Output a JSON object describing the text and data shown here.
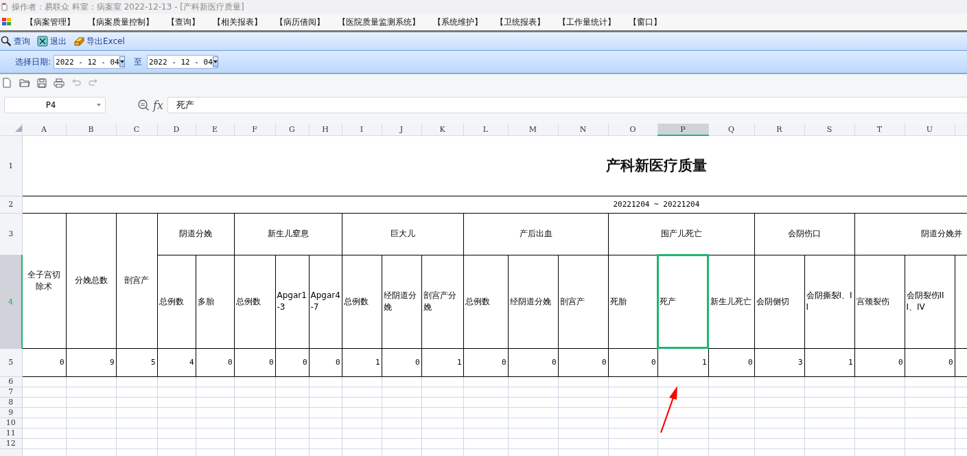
{
  "title_bar": {
    "text": "操作者：易联众  科室：病案室  2022-12-13 - [产科新医疗质量]"
  },
  "menu": [
    "【病案管理】",
    "【病案质量控制】",
    "【查询】",
    "【相关报表】",
    "【病历借阅】",
    "【医院质量监测系统】",
    "【系统维护】",
    "【卫统报表】",
    "【工作量统计】",
    "【窗口】"
  ],
  "toolbar": [
    {
      "kind": "search",
      "label": "查询"
    },
    {
      "kind": "exit",
      "label": "退出"
    },
    {
      "kind": "export",
      "label": "导出Excel"
    }
  ],
  "date_filter": {
    "label": "选择日期:",
    "from": "2022 - 12 - 04",
    "separator": "至",
    "to": "2022 - 12 - 04"
  },
  "formula_bar": {
    "cell_ref": "P4",
    "function_label": "fx",
    "formula": "死产"
  },
  "sheet": {
    "columns": [
      {
        "label": "A",
        "selected": false
      },
      {
        "label": "B",
        "selected": false
      },
      {
        "label": "C",
        "selected": false
      },
      {
        "label": "D",
        "selected": false
      },
      {
        "label": "E",
        "selected": false
      },
      {
        "label": "F",
        "selected": false
      },
      {
        "label": "G",
        "selected": false
      },
      {
        "label": "H",
        "selected": false
      },
      {
        "label": "I",
        "selected": false
      },
      {
        "label": "J",
        "selected": false
      },
      {
        "label": "K",
        "selected": false
      },
      {
        "label": "L",
        "selected": false
      },
      {
        "label": "M",
        "selected": false
      },
      {
        "label": "N",
        "selected": false
      },
      {
        "label": "O",
        "selected": false
      },
      {
        "label": "P",
        "selected": true
      },
      {
        "label": "Q",
        "selected": false
      },
      {
        "label": "R",
        "selected": false
      },
      {
        "label": "S",
        "selected": false
      },
      {
        "label": "T",
        "selected": false
      },
      {
        "label": "U",
        "selected": false
      }
    ],
    "rows": [
      {
        "label": "1",
        "selected": false
      },
      {
        "label": "2",
        "selected": false
      },
      {
        "label": "3",
        "selected": false
      },
      {
        "label": "4",
        "selected": true
      },
      {
        "label": "5",
        "selected": false
      },
      {
        "label": "6",
        "selected": false
      },
      {
        "label": "7",
        "selected": false
      },
      {
        "label": "8",
        "selected": false
      },
      {
        "label": "9",
        "selected": false
      },
      {
        "label": "10",
        "selected": false
      },
      {
        "label": "11",
        "selected": false
      },
      {
        "label": "12",
        "selected": false
      }
    ],
    "title": "产科新医疗质量",
    "date_range": "20221204  ~  20221204",
    "headers": [
      {
        "label": "全子宫切除术",
        "value": "0",
        "selected": false
      },
      {
        "label": "分娩总数",
        "value": "9",
        "selected": false
      },
      {
        "label": "剖宫产",
        "value": "5",
        "selected": false
      },
      {
        "label": "阴道分娩",
        "children": [
          {
            "label": "总例数",
            "value": "4",
            "selected": false
          },
          {
            "label": "多胎",
            "value": "0",
            "selected": false
          }
        ]
      },
      {
        "label": "新生儿窒息",
        "children": [
          {
            "label": "总例数",
            "value": "0",
            "selected": false
          },
          {
            "label": "Apgar1-3",
            "value": "0",
            "selected": false
          },
          {
            "label": "Apgar4-7",
            "value": "0",
            "selected": false
          }
        ]
      },
      {
        "label": "巨大儿",
        "children": [
          {
            "label": "总例数",
            "value": "1",
            "selected": false
          },
          {
            "label": "经阴道分娩",
            "value": "0",
            "selected": false
          },
          {
            "label": "剖宫产分娩",
            "value": "1",
            "selected": false
          }
        ]
      },
      {
        "label": "产后出血",
        "children": [
          {
            "label": "总例数",
            "value": "0",
            "selected": false
          },
          {
            "label": "经阴道分娩",
            "value": "0",
            "selected": false
          },
          {
            "label": "剖宫产",
            "value": "0",
            "selected": false
          }
        ]
      },
      {
        "label": "围产儿死亡",
        "children": [
          {
            "label": "死胎",
            "value": "0",
            "selected": false
          },
          {
            "label": "死产",
            "value": "1",
            "selected": true
          },
          {
            "label": "新生儿死亡",
            "value": "0",
            "selected": false
          }
        ]
      },
      {
        "label": "会阴伤口",
        "children": [
          {
            "label": "会阴侧切",
            "value": "3",
            "selected": false
          },
          {
            "label": "会阴撕裂I、II",
            "value": "1",
            "selected": false
          }
        ]
      },
      {
        "label": "阴道分娩并",
        "children": [
          {
            "label": "宫颈裂伤",
            "value": "0",
            "selected": false
          },
          {
            "label": "会阴裂伤III、IV",
            "value": "0",
            "selected": false
          },
          {
            "selected": false
          }
        ]
      }
    ]
  }
}
